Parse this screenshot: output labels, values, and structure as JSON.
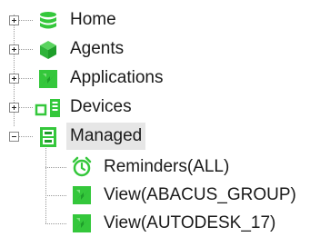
{
  "tree": {
    "items": [
      {
        "label": "Home",
        "icon": "database-icon",
        "expander": "+"
      },
      {
        "label": "Agents",
        "icon": "cube-icon",
        "expander": "+"
      },
      {
        "label": "Applications",
        "icon": "applications-icon",
        "expander": "+"
      },
      {
        "label": "Devices",
        "icon": "devices-icon",
        "expander": "+"
      },
      {
        "label": "Managed",
        "icon": "managed-icon",
        "expander": "-",
        "selected": true,
        "children": [
          {
            "label": "Reminders(ALL)",
            "icon": "alarm-clock-icon"
          },
          {
            "label": "View(ABACUS_GROUP)",
            "icon": "view-icon"
          },
          {
            "label": "View(AUTODESK_17)",
            "icon": "view-icon"
          }
        ]
      }
    ]
  },
  "colors": {
    "green": "#34c73b",
    "dark_green": "#1e9e2a",
    "selection": "#e6e6e6",
    "connector": "#9a9a9a"
  }
}
